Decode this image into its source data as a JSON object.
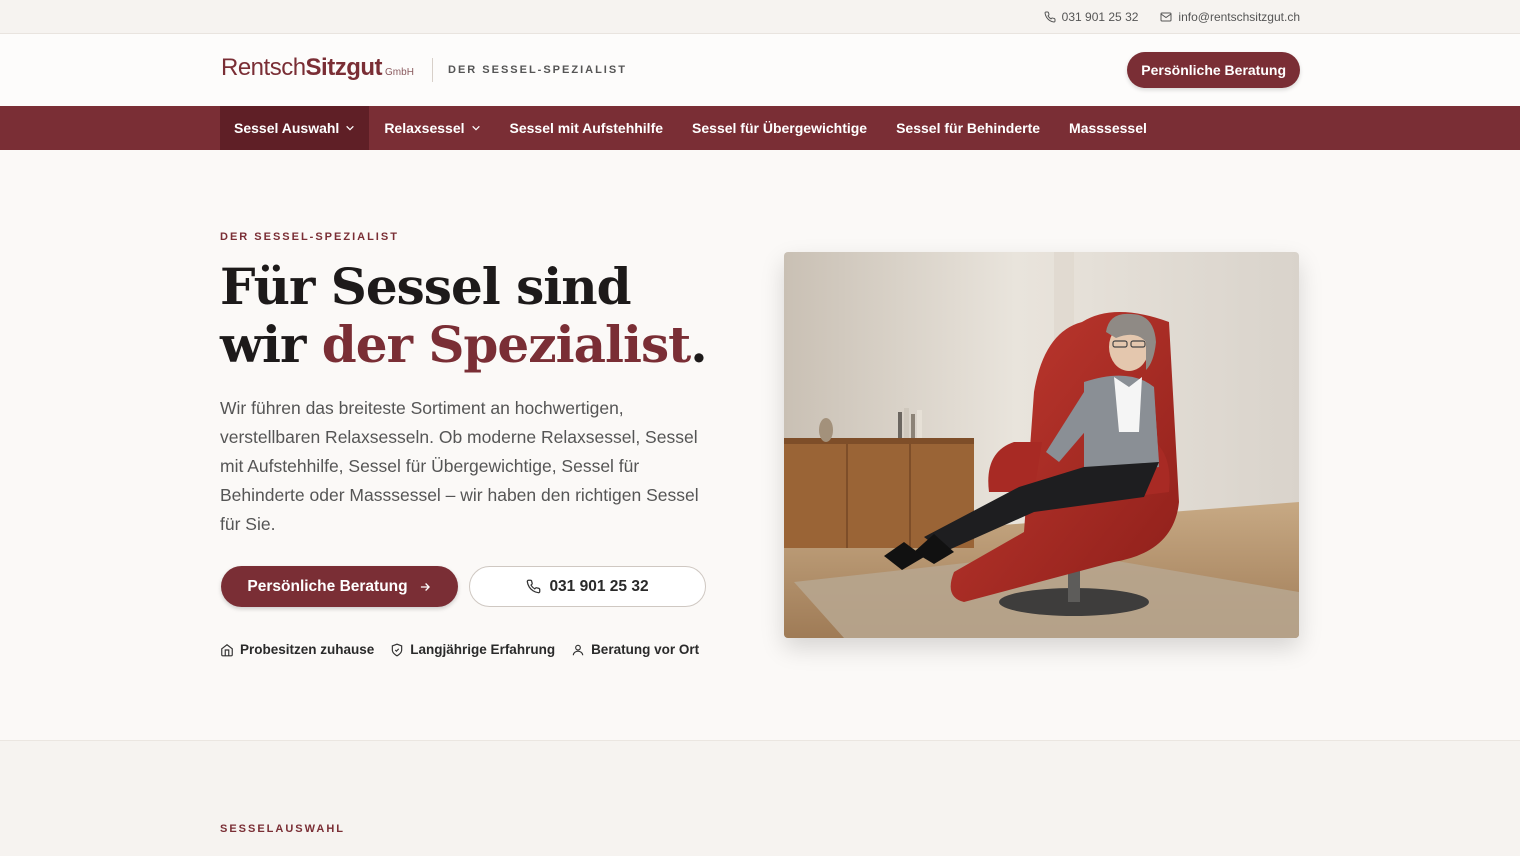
{
  "topbar": {
    "phone": "031 901 25 32",
    "email": "info@rentschsitzgut.ch"
  },
  "header": {
    "logo_part1": "Rentsch",
    "logo_part2": "Sitzgut",
    "logo_suffix": "GmbH",
    "tagline": "DER SESSEL-SPEZIALIST",
    "cta_label": "Persönliche Beratung"
  },
  "nav": {
    "items": [
      {
        "label": "Sessel Auswahl",
        "dropdown": true,
        "active": true
      },
      {
        "label": "Relaxsessel",
        "dropdown": true
      },
      {
        "label": "Sessel mit Aufstehhilfe"
      },
      {
        "label": "Sessel für Übergewichtige"
      },
      {
        "label": "Sessel für Behinderte"
      },
      {
        "label": "Masssessel"
      }
    ]
  },
  "hero": {
    "eyebrow": "DER SESSEL-SPEZIALIST",
    "title_line1": "Für Sessel sind",
    "title_line2_start": "wir ",
    "title_accent": "der Spezialist",
    "title_end": ".",
    "lead": "Wir führen das breiteste Sortiment an hochwertigen, verstellbaren Relaxsesseln. Ob moderne Relaxsessel, Sessel mit Aufstehhilfe, Sessel für Übergewichtige, Sessel für Behinderte oder Masssessel – wir haben den richtigen Sessel für Sie.",
    "primary_button": "Persönliche Beratung",
    "phone_button": "031 901 25 32",
    "features": [
      {
        "label": "Probesitzen zuhause",
        "icon": "home-icon"
      },
      {
        "label": "Langjährige Erfahrung",
        "icon": "shield-icon"
      },
      {
        "label": "Beratung vor Ort",
        "icon": "user-icon"
      }
    ]
  },
  "section2": {
    "eyebrow": "SESSELAUSWAHL"
  },
  "colors": {
    "brand": "#7a2e35",
    "brand_dark": "#5f1f26",
    "background": "#fbf9f7"
  }
}
